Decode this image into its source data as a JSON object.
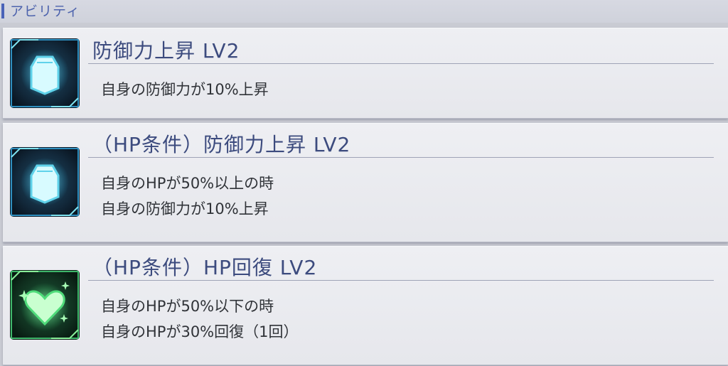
{
  "section": {
    "title": "アビリティ",
    "accent_color": "#4a63b8"
  },
  "abilities": [
    {
      "icon": "shield-icon",
      "icon_color": "#7fe3f0",
      "title": "防御力上昇 LV2",
      "lines": [
        "自身の防御力が10%上昇"
      ]
    },
    {
      "icon": "shield-icon",
      "icon_color": "#7fe3f0",
      "title": "（HP条件）防御力上昇 LV2",
      "lines": [
        "自身のHPが50%以上の時",
        "自身の防御力が10%上昇"
      ]
    },
    {
      "icon": "heart-heal-icon",
      "icon_color": "#8af09a",
      "title": "（HP条件）HP回復 LV2",
      "lines": [
        "自身のHPが50%以下の時",
        "自身のHPが30%回復（1回）"
      ]
    }
  ]
}
